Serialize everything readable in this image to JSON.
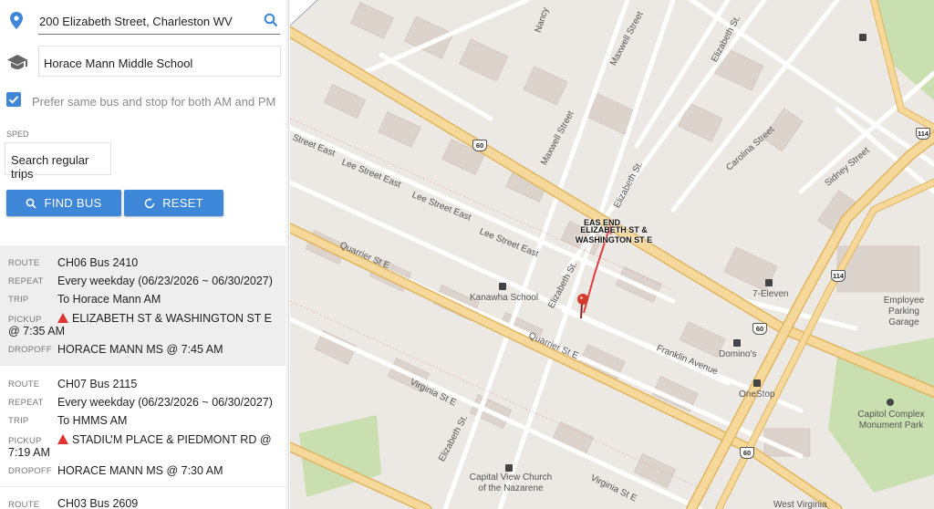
{
  "form": {
    "address_value": "200 Elizabeth Street, Charleston WV",
    "school_value": "Horace Mann Middle School",
    "prefer_same_label": "Prefer same bus and stop for both AM and PM",
    "prefer_same_checked": true,
    "sped_label": "SPED",
    "sped_value": "Search regular trips",
    "find_bus_label": "FIND BUS",
    "reset_label": "RESET"
  },
  "results": {
    "labels": {
      "route": "ROUTE",
      "repeat": "REPEAT",
      "trip": "TRIP",
      "pickup": "PICKUP",
      "dropoff": "DROPOFF"
    },
    "trips": [
      {
        "route": "CH06 Bus 2410",
        "repeat": "Every weekday (06/23/2026 ~ 06/30/2027)",
        "trip": "To Horace Mann AM",
        "pickup": "ELIZABETH ST & WASHINGTON ST E @ 7:35 AM",
        "dropoff": "HORACE MANN MS @ 7:45 AM",
        "selected": true
      },
      {
        "route": "CH07 Bus 2115",
        "repeat": "Every weekday (06/23/2026 ~ 06/30/2027)",
        "trip": "To HMMS AM",
        "pickup": "STADIUM PLACE & PIEDMONT RD @ 7:19 AM",
        "dropoff": "HORACE MANN MS @ 7:30 AM",
        "selected": false
      },
      {
        "route": "CH03 Bus 2609"
      }
    ]
  },
  "map": {
    "stop_label": "ELIZABETH ST & WASHINGTON ST E",
    "stop_label_partial": "EAS  END",
    "streets": {
      "nancy": "Nancy",
      "maxwell_top": "Maxwell Street",
      "maxwell_mid": "Maxwell Street",
      "elizabeth_top": "Elizabeth St.",
      "elizabeth_mid": "Elizabeth St.",
      "elizabeth_low": "Elizabeth St.",
      "elizabeth_bottom": "Elizabeth St.",
      "carolina": "Carolina Street",
      "sidney": "Sidney Street",
      "lee1": "Street East",
      "lee2": "Lee Street East",
      "lee3": "Lee Street East",
      "lee4": "Lee Street East",
      "quarrier1": "Quarrier St E",
      "quarrier2": "Quarrier St E",
      "franklin": "Franklin Avenue",
      "virginia1": "Virginia St E",
      "virginia2": "Virginia St E"
    },
    "pois": {
      "kanawha": "Kanawha School",
      "seven_eleven": "7-Eleven",
      "dominos": "Domino's",
      "onestop": "OneStop",
      "employee_parking": "Employee Parking Garage",
      "capitol_complex": "Capitol Complex Monument Park",
      "capital_view": "Capital View Church of the Nazarene",
      "west_virginia": "West Virginia"
    },
    "shields": [
      "60",
      "60",
      "60",
      "114",
      "114"
    ],
    "colors": {
      "major_road": "#f6d89a",
      "major_road_edge": "#e0b560",
      "park": "#c9dfb0",
      "route_line": "#e23b3b",
      "pin": "#d33a2c"
    }
  }
}
